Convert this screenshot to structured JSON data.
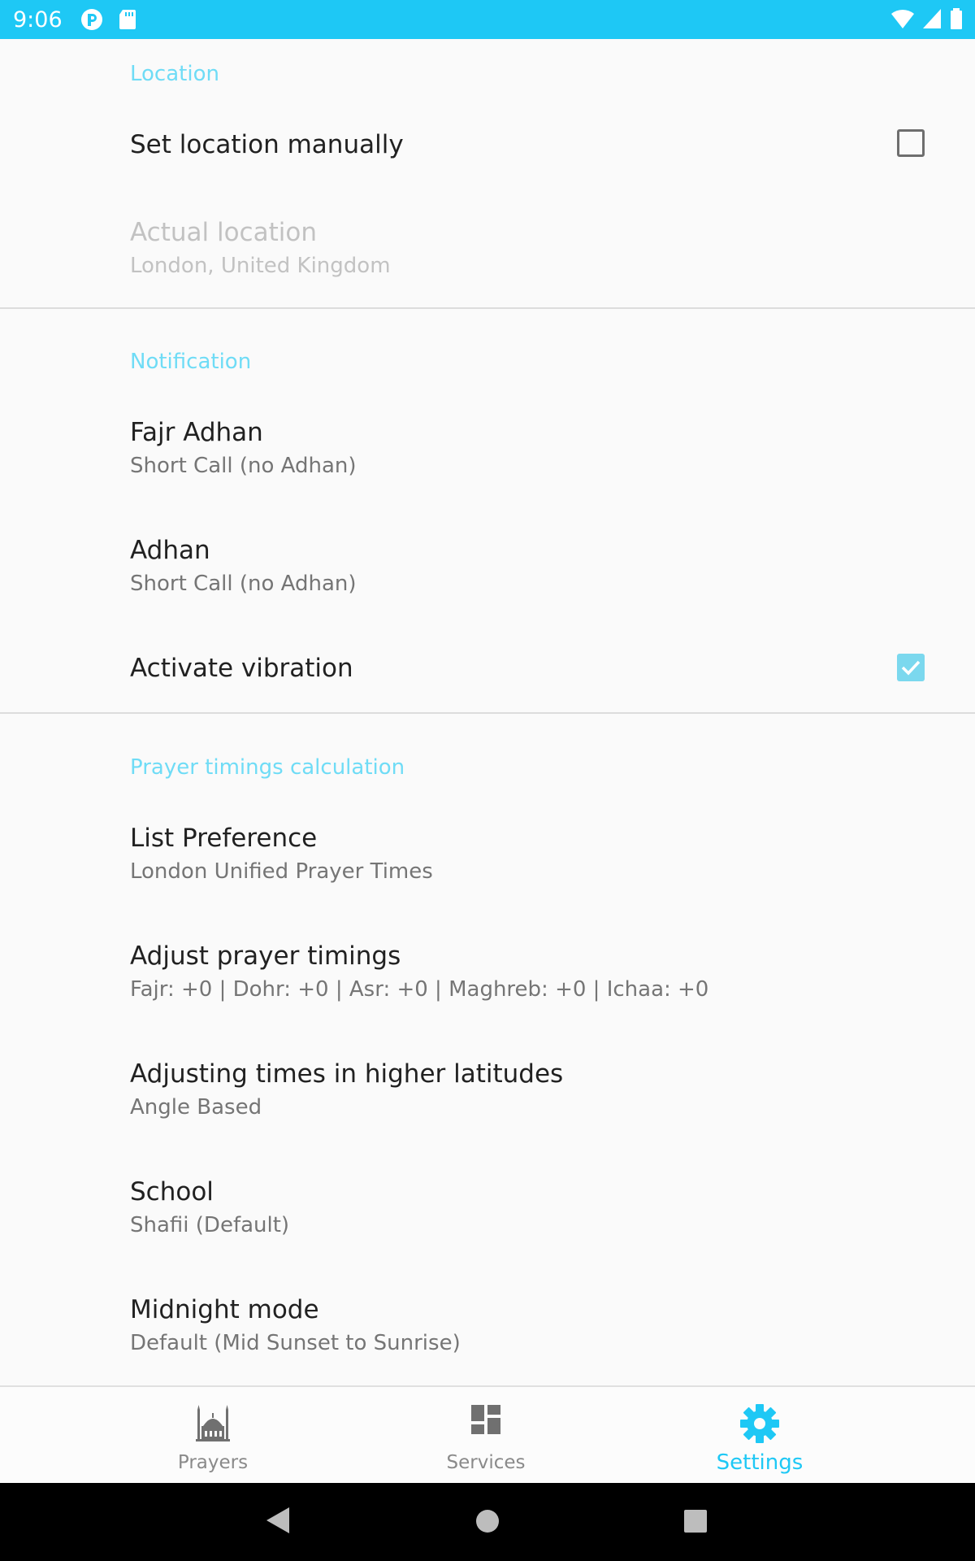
{
  "status_bar": {
    "time": "9:06",
    "left_icons": [
      "app-notification-icon",
      "sd-card-icon"
    ],
    "right_icons": [
      "wifi-icon",
      "signal-icon",
      "battery-icon"
    ],
    "color": "#1ec8f5"
  },
  "sections": {
    "location": {
      "header": "Location",
      "set_manually": {
        "title": "Set location manually",
        "checked": false
      },
      "actual_location": {
        "title": "Actual location",
        "summary": "London, United Kingdom",
        "enabled": false
      }
    },
    "notification": {
      "header": "Notification",
      "fajr_adhan": {
        "title": "Fajr Adhan",
        "summary": "Short Call (no Adhan)"
      },
      "adhan": {
        "title": "Adhan",
        "summary": "Short Call (no Adhan)"
      },
      "vibration": {
        "title": "Activate vibration",
        "checked": true
      }
    },
    "calculation": {
      "header": "Prayer timings calculation",
      "list_preference": {
        "title": "List Preference",
        "summary": "London Unified Prayer Times"
      },
      "adjust_timings": {
        "title": "Adjust prayer timings",
        "summary": "Fajr: +0 | Dohr: +0 | Asr: +0 | Maghreb: +0 | Ichaa: +0"
      },
      "higher_latitudes": {
        "title": "Adjusting times in higher latitudes",
        "summary": "Angle Based"
      },
      "school": {
        "title": "School",
        "summary": "Shafii (Default)"
      },
      "midnight_mode": {
        "title": "Midnight mode",
        "summary": "Default (Mid Sunset to Sunrise)"
      }
    }
  },
  "bottom_nav": {
    "items": [
      {
        "label": "Prayers",
        "icon": "mosque-icon",
        "active": false
      },
      {
        "label": "Services",
        "icon": "dashboard-icon",
        "active": false
      },
      {
        "label": "Settings",
        "icon": "gear-icon",
        "active": true
      }
    ]
  },
  "system_nav": {
    "buttons": [
      "back-icon",
      "home-icon",
      "recents-icon"
    ]
  },
  "colors": {
    "accent": "#1ec8f5",
    "category": "#6fdcf6",
    "checkbox_checked": "#7bd8ee"
  }
}
